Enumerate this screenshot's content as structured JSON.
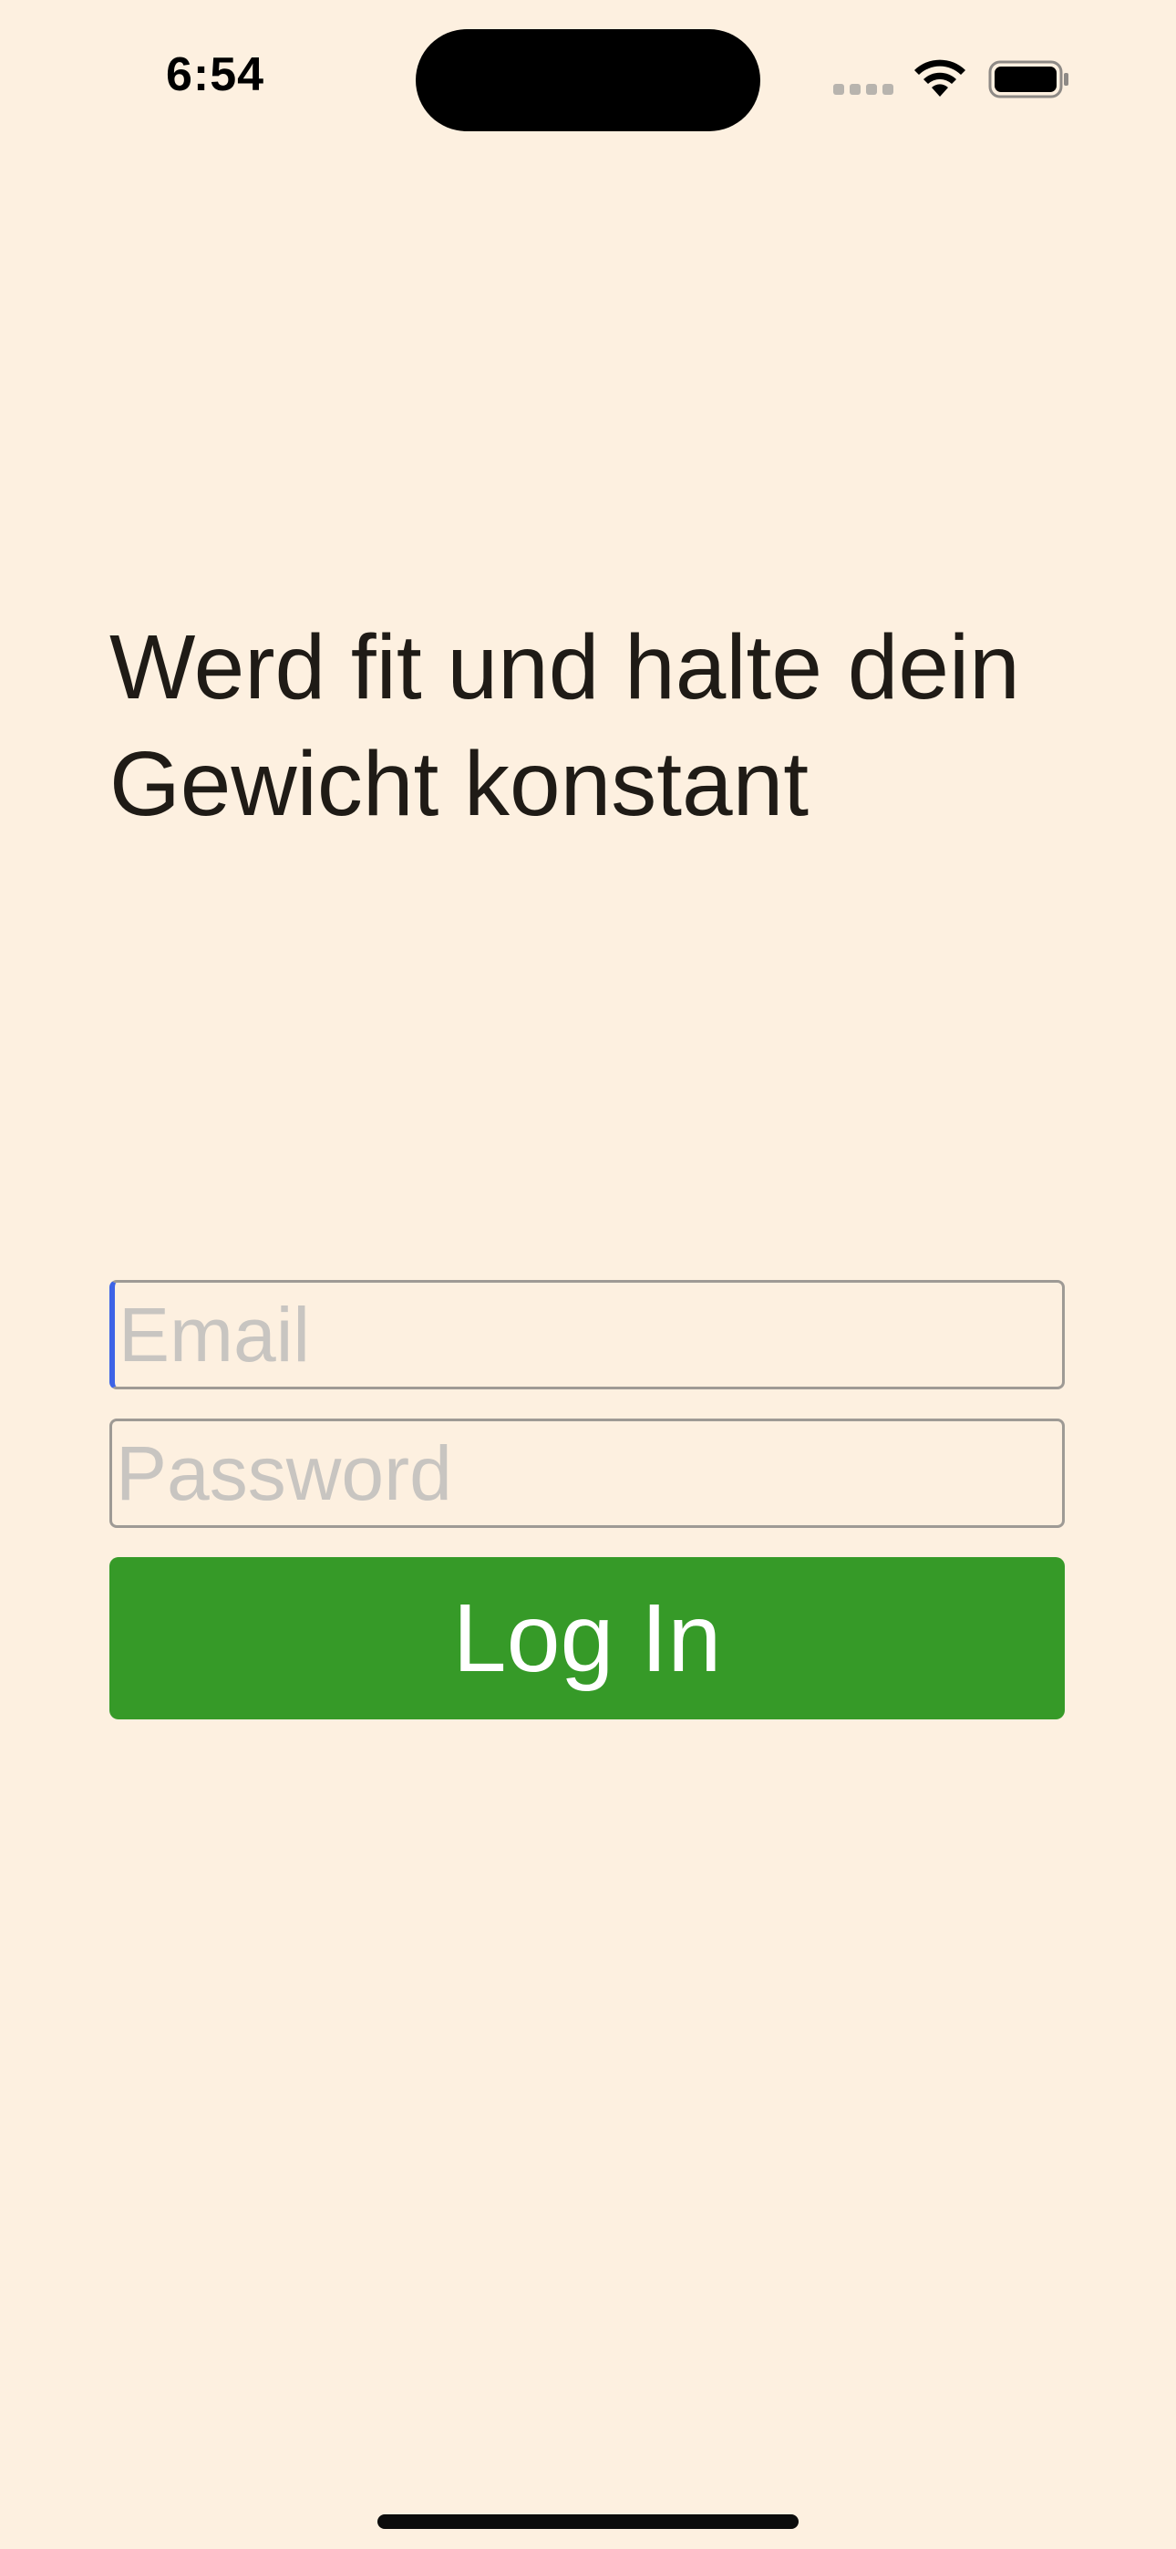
{
  "status_bar": {
    "time": "6:54",
    "icons": [
      "cellular-signal-icon",
      "wifi-icon",
      "battery-icon"
    ]
  },
  "login": {
    "headline": "Werd fit und halte dein Gewicht konstant",
    "email_placeholder": "Email",
    "email_value": "",
    "password_placeholder": "Password",
    "password_value": "",
    "login_button": "Log In"
  },
  "colors": {
    "background": "#fdf0e0",
    "primary_button": "#369a28",
    "text": "#1f1b16",
    "placeholder": "#c8c5c1",
    "cursor": "#3d63e6"
  }
}
